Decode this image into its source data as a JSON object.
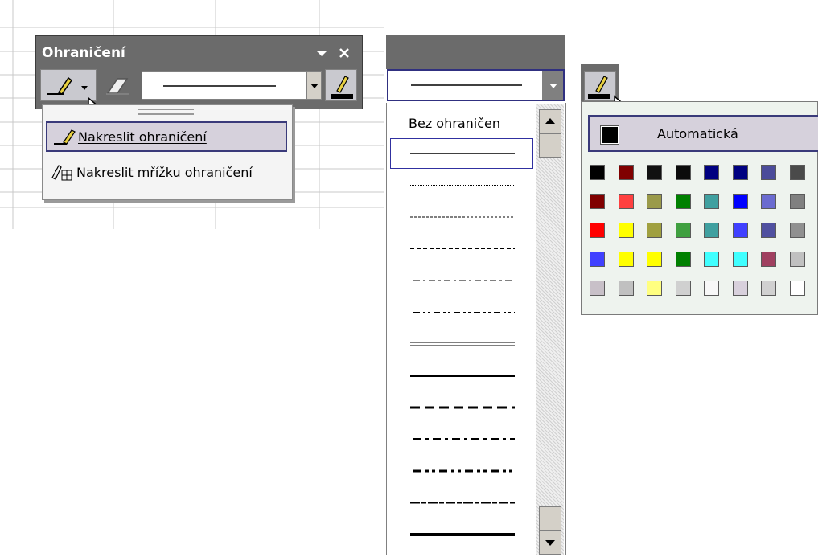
{
  "toolbar": {
    "title": "Ohraničení",
    "menu_items": [
      {
        "label": "Nakreslit ohraničení",
        "icon": "pencil-icon"
      },
      {
        "label": "Nakreslit mřížku ohraničení",
        "icon": "grid-pencil-icon"
      }
    ]
  },
  "line_style": {
    "none_label": "Bez ohraničen",
    "styles": [
      "thin",
      "dotted",
      "fine-dashed",
      "dashed",
      "dash-dot",
      "dash-dot-dot",
      "double",
      "medium",
      "medium-dashed",
      "medium-dash-dot",
      "medium-dash-dot-dot",
      "slant-dash-dot",
      "thick"
    ]
  },
  "color": {
    "auto_label": "Automatická",
    "swatches": [
      [
        "#000000",
        "#800000",
        "#111111",
        "#0b0b0b",
        "#000080",
        "#000080",
        "#4b4b9a",
        "#4a4a4a"
      ],
      [
        "#800000",
        "#ff4040",
        "#9a9a4a",
        "#008000",
        "#40a0a0",
        "#0000ff",
        "#6b6bd0",
        "#808080"
      ],
      [
        "#ff0000",
        "#ffff00",
        "#a0a040",
        "#40a040",
        "#40a0a0",
        "#4040ff",
        "#5050a0",
        "#909090"
      ],
      [
        "#4040ff",
        "#ffff00",
        "#ffff00",
        "#008000",
        "#40ffff",
        "#40ffff",
        "#a04060",
        "#c0c0c0"
      ],
      [
        "#c8c0c8",
        "#c0c0c0",
        "#ffff80",
        "#d0d0d0",
        "#f8f8f8",
        "#d8d0dc",
        "#d0d0d0",
        "#ffffff"
      ]
    ]
  }
}
